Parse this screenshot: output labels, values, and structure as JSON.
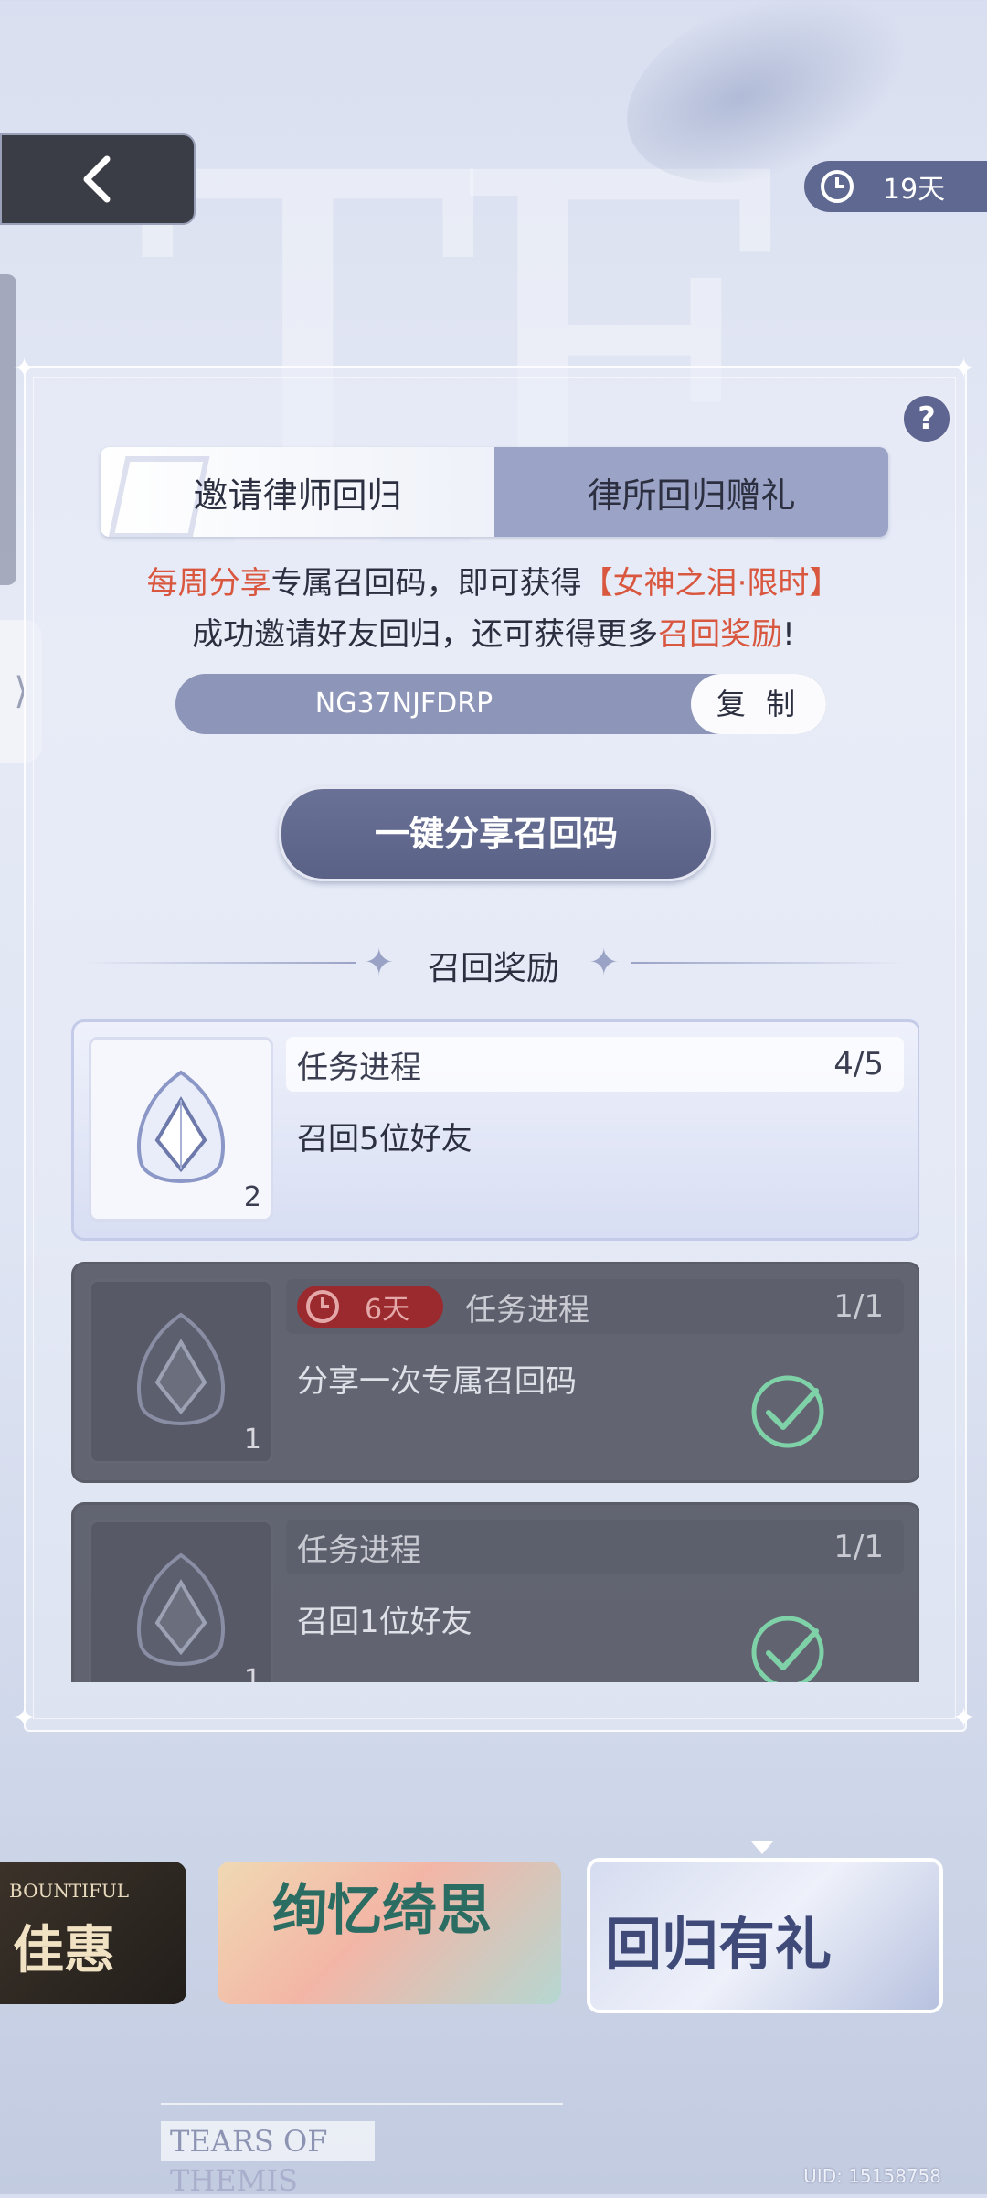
{
  "header": {
    "timer_text": "19天"
  },
  "help_label": "?",
  "side_tab_glyph": "⟩",
  "tabs": [
    {
      "label": "邀请律师回归",
      "active": true
    },
    {
      "label": "律所回归赠礼",
      "active": false
    }
  ],
  "intro": {
    "line1_red1": "每周分享",
    "line1_mid": "专属召回码，即可获得",
    "line1_red2": "【女神之泪·限时】",
    "line2_start": "成功邀请好友回归，还可获得更多",
    "line2_red": "召回奖励",
    "line2_end": "!"
  },
  "recall_code": {
    "code": "NG37NJFDRP",
    "copy_label": "复 制"
  },
  "share_button_label": "一键分享召回码",
  "section_title": "召回奖励",
  "tasks": [
    {
      "label": "任务进程",
      "progress": "4/5",
      "description": "召回5位好友",
      "quantity": "2",
      "state": "in-progress",
      "timer": ""
    },
    {
      "label": "任务进程",
      "progress": "1/1",
      "description": "分享一次专属召回码",
      "quantity": "1",
      "state": "completed",
      "timer": "6天"
    },
    {
      "label": "任务进程",
      "progress": "1/1",
      "description": "召回1位好友",
      "quantity": "1",
      "state": "completed",
      "timer": ""
    }
  ],
  "carousel": [
    {
      "subtitle": "BOUNTIFUL",
      "title": "佳惠"
    },
    {
      "title": "绚忆绮思"
    },
    {
      "title": "回归有礼",
      "selected": true
    }
  ],
  "footer": {
    "logo_line1": "TEARS OF",
    "logo_line2": "THEMIS",
    "uid": "UID: 15158758"
  },
  "colors": {
    "accent_red": "#d9573f",
    "panel_purple": "#5f6890",
    "timer_red": "#9b2a2e",
    "check_green": "#7fd1a8"
  }
}
